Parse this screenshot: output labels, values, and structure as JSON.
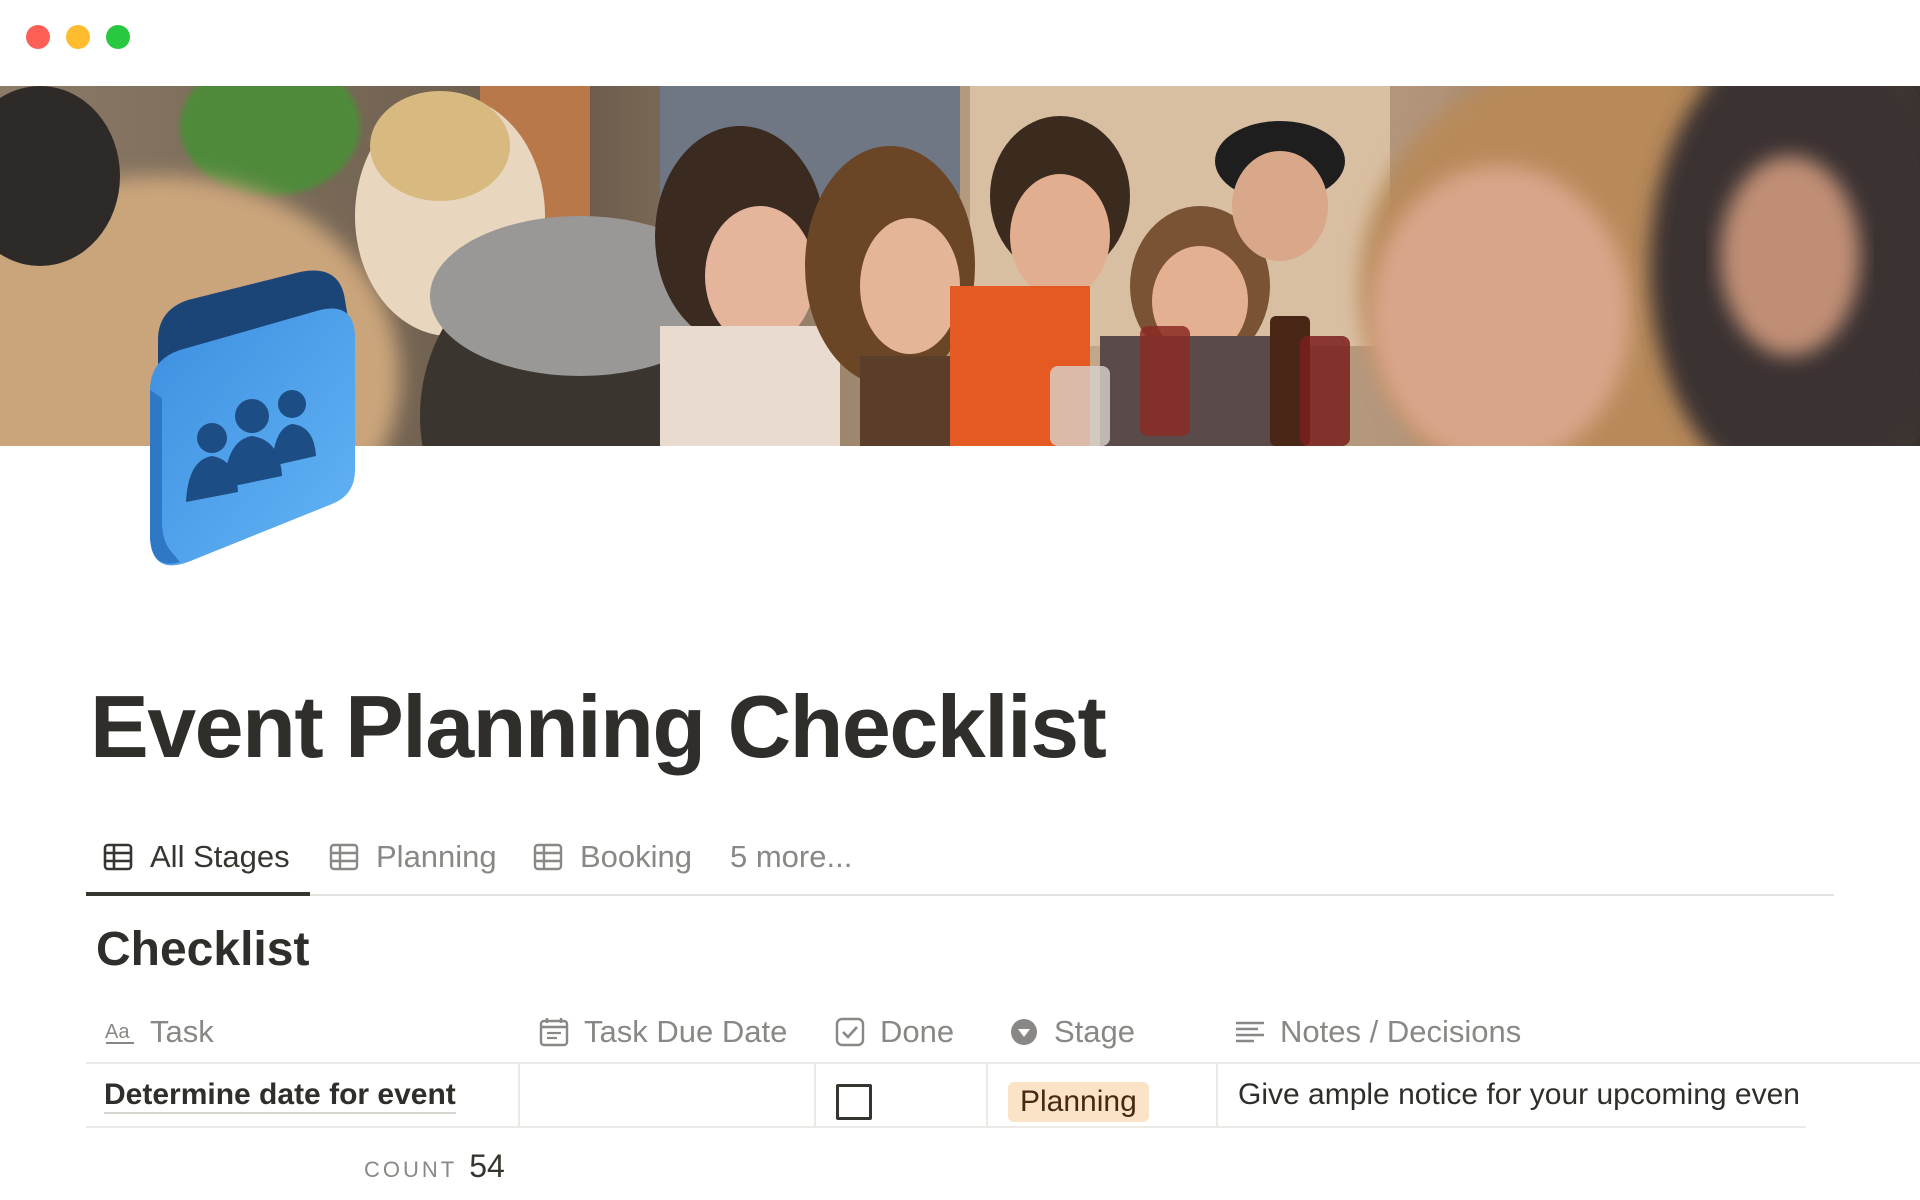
{
  "page": {
    "title": "Event Planning Checklist"
  },
  "tabs": [
    {
      "label": "All Stages",
      "icon": "table-icon",
      "active": true
    },
    {
      "label": "Planning",
      "icon": "table-icon",
      "active": false
    },
    {
      "label": "Booking",
      "icon": "table-icon",
      "active": false
    },
    {
      "label": "5 more...",
      "icon": "",
      "active": false
    }
  ],
  "database": {
    "title": "Checklist",
    "columns": [
      {
        "label": "Task",
        "icon": "text-aa-icon"
      },
      {
        "label": "Task Due Date",
        "icon": "calendar-icon"
      },
      {
        "label": "Done",
        "icon": "checkbox-icon"
      },
      {
        "label": "Stage",
        "icon": "select-icon"
      },
      {
        "label": "Notes / Decisions",
        "icon": "text-lines-icon"
      }
    ],
    "rows": [
      {
        "task": "Determine date for event",
        "due_date": "",
        "done": false,
        "stage": "Planning",
        "notes": "Give ample notice for your upcoming even"
      }
    ],
    "count_label": "COUNT",
    "count_value": "54"
  },
  "colors": {
    "stage_planning_bg": "#fae3c7",
    "stage_planning_text": "#49290e",
    "icon_blue": "#3b8ee6",
    "icon_dark_blue": "#1a3f6f"
  }
}
